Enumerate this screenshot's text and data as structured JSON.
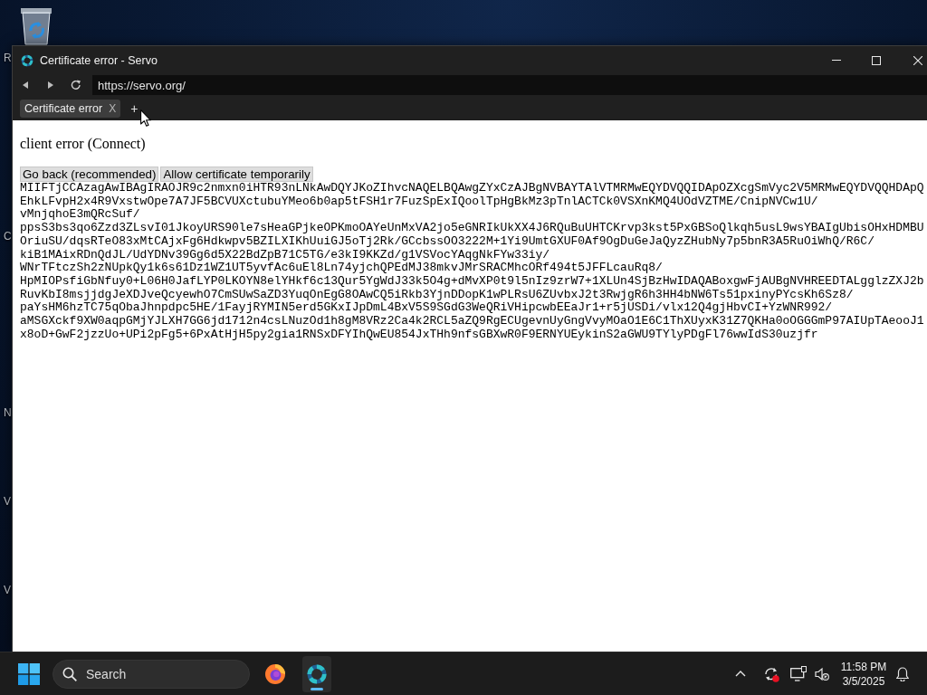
{
  "desktop": {
    "icon_labels": [
      "R",
      "C",
      "N",
      "V",
      "V"
    ]
  },
  "window": {
    "title": "Certificate error - Servo"
  },
  "toolbar": {
    "url": "https://servo.org/"
  },
  "tabs": [
    {
      "label": "Certificate error",
      "close": "X",
      "selected": true
    }
  ],
  "new_tab": "+",
  "page": {
    "heading": "client error (Connect)",
    "buttons": [
      "Go back (recommended)",
      "Allow certificate temporarily"
    ],
    "certificate_lines": [
      "MIIFTjCCAzagAwIBAgIRAOJR9c2nmxn0iHTR93nLNkAwDQYJKoZIhvcNAQELBQAwgZYxCzAJBgNVBAYTAlVTMRMwEQYDVQQIDApOZXcgSmVyc2V5MRMwEQYDVQQHDApQ",
      "EhkLFvpH2x4R9VxstwOpe7A7JF5BCVUXctubuYMeo6b0ap5tFSH1r7FuzSpExIQoolTpHgBkMz3pTnlACTCk0VSXnKMQ4UOdVZTME/CnipNVCw1U/",
      "vMnjqhoE3mQRcSuf/",
      "ppsS3bs3qo6Zzd3ZLsvI01JkoyURS90le7sHeaGPjkeOPKmoOAYeUnMxVA2jo5eGNRIkUkXX4J6RQuBuUHTCKrvp3kst5PxGBSoQlkqh5usL9wsYBAIgUbisOHxHDMBU",
      "OriuSU/dqsRTeO83xMtCAjxFg6Hdkwpv5BZILXIKhUuiGJ5oTj2Rk/GCcbssOO3222M+1Yi9UmtGXUF0Af9OgDuGeJaQyzZHubNy7p5bnR3A5RuOiWhQ/R6C/",
      "kiB1MAixRDnQdJL/UdYDNv39Gg6d5X22BdZpB71C5TG/e3kI9KKZd/g1VSVocYAqgNkFYw33iy/",
      "WNrTFtczSh2zNUpkQy1k6s61Dz1WZ1UT5yvfAc6uEl8Ln74yjchQPEdMJ38mkvJMrSRACMhcORf494t5JFFLcauRq8/",
      "HpMIOPsfiGbNfuy0+L06H0JafLYP0LKOYN8elYHkf6c13Qur5YgWdJ33k5O4g+dMvXP0t9l5nIz9zrW7+1XLUn4SjBzHwIDAQABoxgwFjAUBgNVHREEDTALgglzZXJ2b",
      "RuvKbI8msjjdgJeXDJveQcyewhO7CmSUwSaZD3YuqOnEgG8OAwCQ5iRkb3YjnDDopK1wPLRsU6ZUvbxJ2t3RwjgR6h3HH4bNW6Ts51pxinyPYcsKh6Sz8/",
      "paYsHM6hzTC75qObaJhnpdpc5HE/1FayjRYMIN5erd5GKxIJpDmL4BxV5S9SGdG3WeQRiVHipcwbEEaJr1+r5jUSDi/vlx12Q4gjHbvCI+YzWNR992/",
      "aMSGXckf9XW0aqpGMjYJLXH7GG6jd1712n4csLNuzOd1h8gM8VRz2Ca4k2RCL5aZQ9RgECUgevnUyGngVvyMOaO1E6C1ThXUyxK31Z7QKHa0oOGGGmP97AIUpTAeooJ1",
      "x8oD+GwF2jzzUo+UPi2pFg5+6PxAtHjH5py2gia1RNSxDFYIhQwEU854JxTHh9nfsGBXwR0F9ERNYUEykinS2aGWU9TYlyPDgFl76wwIdS30uzjfr"
    ]
  },
  "taskbar": {
    "search_placeholder": "Search",
    "apps": [
      {
        "kind": "firefox",
        "active": false
      },
      {
        "kind": "servo",
        "active": true
      }
    ],
    "time": "11:58 PM",
    "date": "3/5/2025"
  }
}
